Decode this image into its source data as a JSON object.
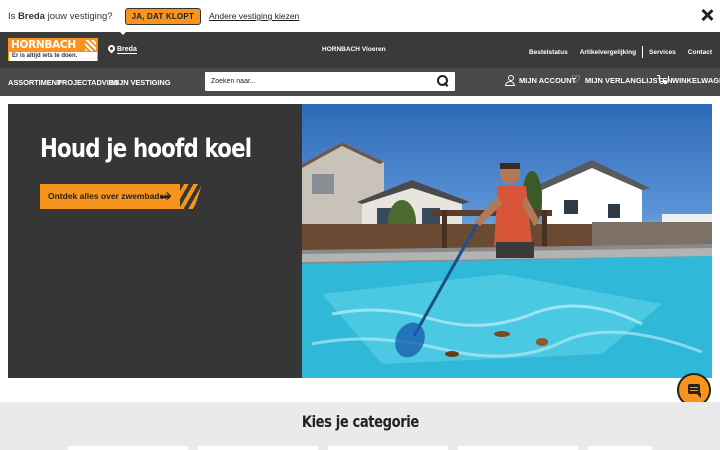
{
  "store_prompt": {
    "prefix": "Is",
    "store": "Breda",
    "suffix": "jouw vestiging?",
    "confirm_label": "JA, DAT KLOPT",
    "other_label": "Andere vestiging kiezen"
  },
  "header": {
    "logo_top": "HORNBACH",
    "logo_slogan": "Er is altijd iets te doen.",
    "location": "Breda",
    "center_link": "HORNBACH Vloeren",
    "links": [
      "Bestelstatus",
      "Artikelvergelijking",
      "Services",
      "Contact"
    ]
  },
  "nav": {
    "items": [
      "ASSORTIMENT",
      "PROJECTADVIES",
      "MIJN VESTIGING"
    ],
    "search_placeholder": "Zoeken naar...",
    "account": "MIJN ACCOUNT",
    "wishlist": "MIJN VERLANGLIJSTEN",
    "cart": "WINKELWAGEN"
  },
  "hero": {
    "title": "Houd je hoofd koel",
    "cta": "Ontdek alles over zwembaden"
  },
  "categories": {
    "title": "Kies je categorie"
  },
  "colors": {
    "accent": "#f7941d",
    "header_bg": "#3a3a3a",
    "nav_bg": "#4a4a4a",
    "hero_panel": "#363636"
  }
}
